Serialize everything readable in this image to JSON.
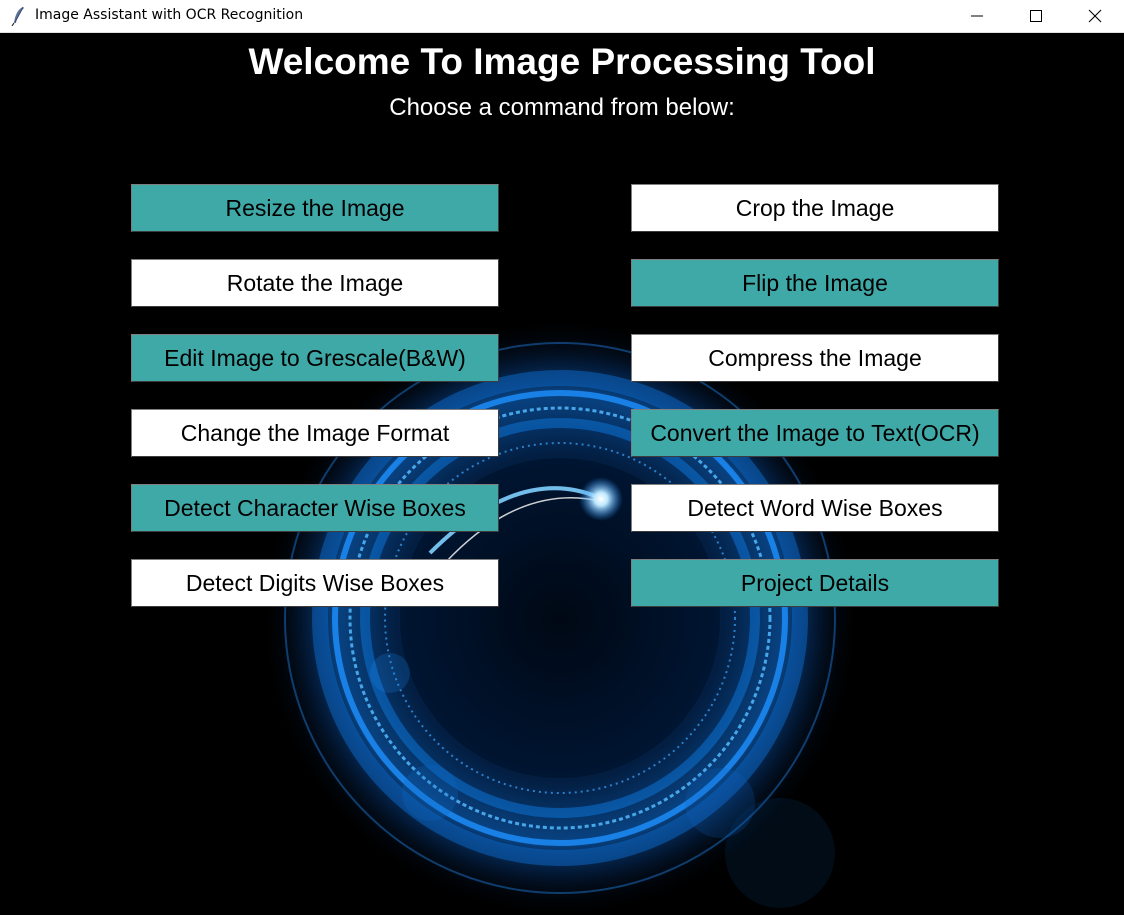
{
  "window": {
    "title": "Image Assistant with OCR Recognition",
    "icon": "feather-icon",
    "controls": [
      "minimize-icon",
      "maximize-icon",
      "close-icon"
    ]
  },
  "main": {
    "heading": "Welcome To Image Processing Tool",
    "subheading": "Choose a command from below:"
  },
  "commands": [
    {
      "label": "Resize the Image",
      "style": "teal"
    },
    {
      "label": "Crop the Image",
      "style": "white"
    },
    {
      "label": "Rotate the Image",
      "style": "white"
    },
    {
      "label": "Flip the Image",
      "style": "teal"
    },
    {
      "label": "Edit Image to Grescale(B&W)",
      "style": "teal"
    },
    {
      "label": "Compress the Image",
      "style": "white"
    },
    {
      "label": "Change the Image Format",
      "style": "white"
    },
    {
      "label": "Convert the Image to Text(OCR)",
      "style": "teal"
    },
    {
      "label": "Detect Character Wise Boxes",
      "style": "teal"
    },
    {
      "label": "Detect Word Wise Boxes",
      "style": "white"
    },
    {
      "label": "Detect Digits Wise Boxes",
      "style": "white"
    },
    {
      "label": "Project Details",
      "style": "teal"
    }
  ],
  "colors": {
    "teal_button": "#3fa9a8",
    "white_button": "#ffffff",
    "background": "#000000",
    "glow": "#1e90ff"
  }
}
